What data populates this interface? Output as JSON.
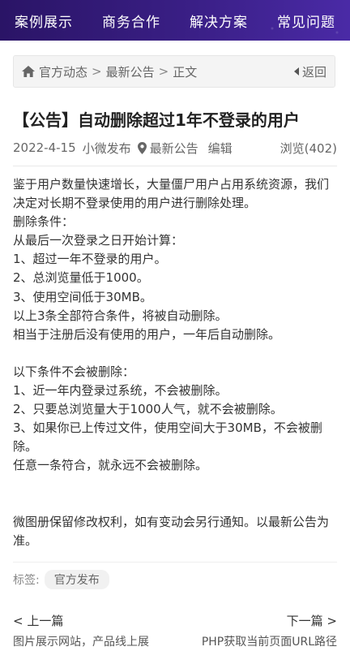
{
  "nav": {
    "items": [
      "案例展示",
      "商务合作",
      "解决方案",
      "常见问题"
    ]
  },
  "breadcrumb": {
    "home_icon": "home-icon",
    "items": [
      "官方动态",
      "最新公告",
      "正文"
    ],
    "separator": ">",
    "back_label": "返回"
  },
  "article": {
    "title": "【公告】自动删除超过1年不登录的用户",
    "date": "2022-4-15",
    "author": "小微发布",
    "category_icon": "location-pin-icon",
    "category": "最新公告",
    "edit_label": "编辑",
    "views_label": "浏览(402)",
    "paragraphs": [
      "鉴于用户数量快速增长，大量僵尸用户占用系统资源，我们决定对长期不登录使用的用户进行删除处理。",
      "删除条件：",
      "从最后一次登录之日开始计算：",
      "1、超过一年不登录的用户。",
      "2、总浏览量低于1000。",
      "3、使用空间低于30MB。",
      "以上3条全部符合条件，将被自动删除。",
      "相当于注册后没有使用的用户，一年后自动删除。",
      "",
      "以下条件不会被删除：",
      "1、近一年内登录过系统，不会被删除。",
      "2、只要总浏览量大于1000人气，就不会被删除。",
      "3、如果你已上传过文件，使用空间大于30MB，不会被删除。",
      "任意一条符合，就永远不会被删除。",
      "",
      "",
      "微图册保留修改权利，如有变动会另行通知。以最新公告为准。"
    ]
  },
  "tags": {
    "label": "标签:",
    "items": [
      "官方发布"
    ]
  },
  "pager": {
    "prev_label": "< 上一篇",
    "next_label": "下一篇 >",
    "prev_title": "图片展示网站，产品线上展",
    "next_title": "PHP获取当前页面URL路径"
  },
  "colors": {
    "nav_bg_start": "#2a1466",
    "nav_bg_end": "#4a2aa6",
    "text": "#333333"
  }
}
